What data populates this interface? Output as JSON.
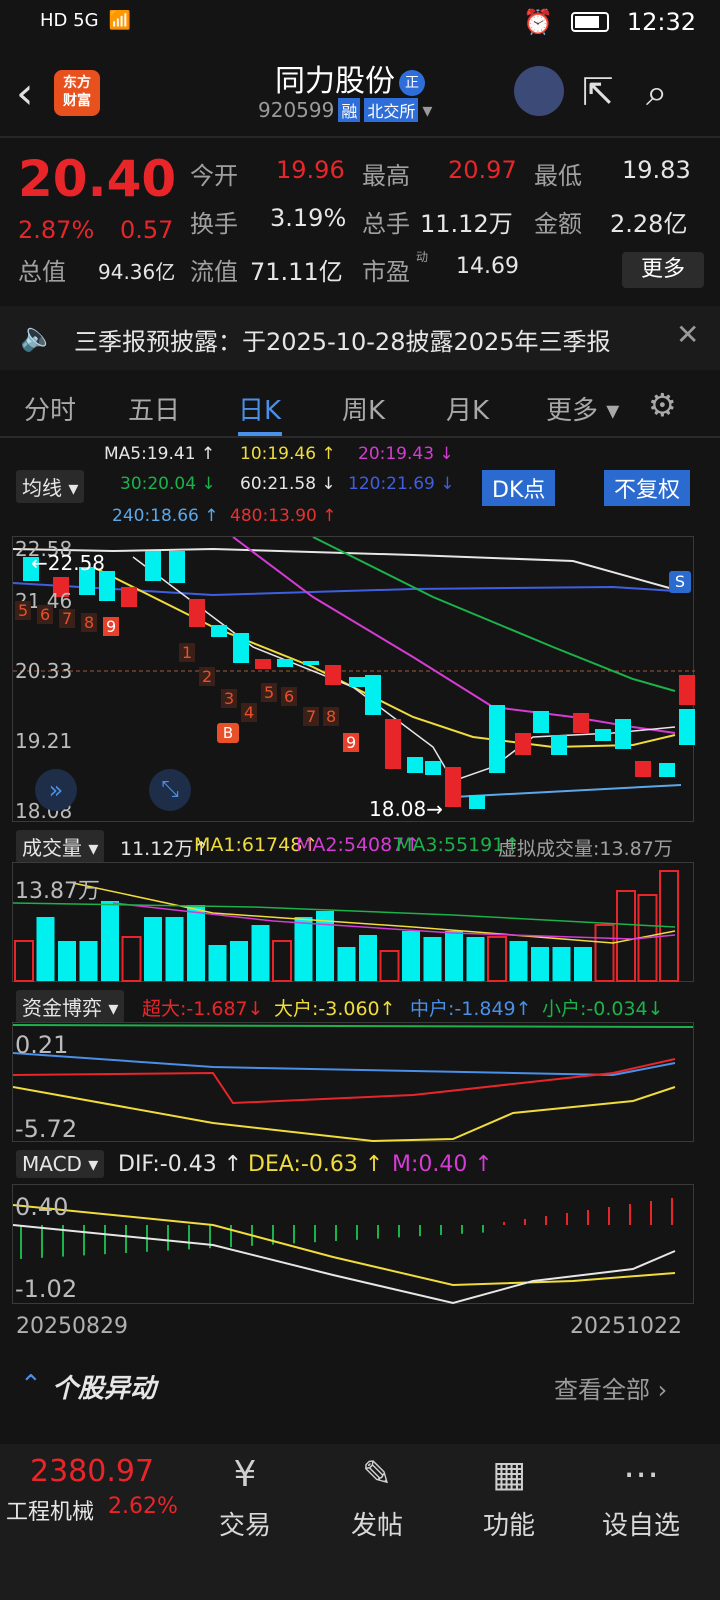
{
  "status": {
    "time": "12:32",
    "left_icons": "HD 5G"
  },
  "header": {
    "logo_line1": "东方",
    "logo_line2": "财富",
    "name": "同力股份",
    "badge": "正",
    "code": "920599",
    "tag1": "融",
    "tag2": "北交所"
  },
  "quote": {
    "price": "20.40",
    "pct": "2.87%",
    "chg": "0.57",
    "open_label": "今开",
    "open": "19.96",
    "high_label": "最高",
    "high": "20.97",
    "low_label": "最低",
    "low": "19.83",
    "turnover_label": "换手",
    "turnover": "3.19%",
    "volume_label": "总手",
    "volume": "11.12万",
    "amount_label": "金额",
    "amount": "2.28亿",
    "mktcap_label": "总值",
    "mktcap": "94.36亿",
    "float_label": "流值",
    "float": "71.11亿",
    "pe_label": "市盈",
    "pe_sup": "动",
    "pe": "14.69",
    "more": "更多"
  },
  "notice": {
    "text": "三季报预披露：于2025-10-28披露2025年三季报"
  },
  "tabs": [
    "分时",
    "五日",
    "日K",
    "周K",
    "月K",
    "更多"
  ],
  "ma": {
    "ma5": "MA5:19.41 ↑",
    "ma10": "10:19.46 ↑",
    "ma20": "20:19.43 ↓",
    "ma30": "30:20.04 ↓",
    "ma60": "60:21.58 ↓",
    "ma120": "120:21.69 ↓",
    "ma240": "240:18.66 ↑",
    "ma480": "480:13.90 ↑",
    "selector": "均线",
    "dk": "DK点",
    "fq": "不复权"
  },
  "kline": {
    "ymax": "22.58",
    "y2": "21.46",
    "y3": "20.33",
    "y4": "19.21",
    "ymin": "18.08",
    "high_mark": "←22.58",
    "low_mark": "18.08→",
    "s_badge": "S",
    "b_badge": "B",
    "seq_top": [
      "5",
      "6",
      "7",
      "8",
      "9"
    ],
    "seq_mid": [
      "1",
      "2",
      "3",
      "4",
      "5",
      "6",
      "7",
      "8",
      "9"
    ]
  },
  "volume": {
    "selector": "成交量",
    "val": "11.12万↑",
    "ma1": "MA1:61748↑",
    "ma2": "MA2:54087↑",
    "ma3": "MA3:55191↑",
    "virtual": "虚拟成交量:13.87万",
    "axis": "13.87万"
  },
  "capital": {
    "selector": "资金博弈",
    "xl": "超大:-1.687↓",
    "big": "大户:-3.060↑",
    "mid": "中户:-1.849↑",
    "small": "小户:-0.034↓",
    "top": "0.21",
    "bottom": "-5.72"
  },
  "macd": {
    "selector": "MACD",
    "dif": "DIF:-0.43 ↑",
    "dea": "DEA:-0.63 ↑",
    "m": "M:0.40 ↑",
    "top": "0.40",
    "bottom": "-1.02"
  },
  "dates": {
    "start": "20250829",
    "end": "20251022"
  },
  "section": {
    "title": "个股异动",
    "link": "查看全部"
  },
  "bottom": {
    "index_val": "2380.97",
    "index_name": "工程机械",
    "index_pct": "2.62%",
    "nav": [
      "交易",
      "发帖",
      "功能",
      "设自选"
    ]
  }
}
